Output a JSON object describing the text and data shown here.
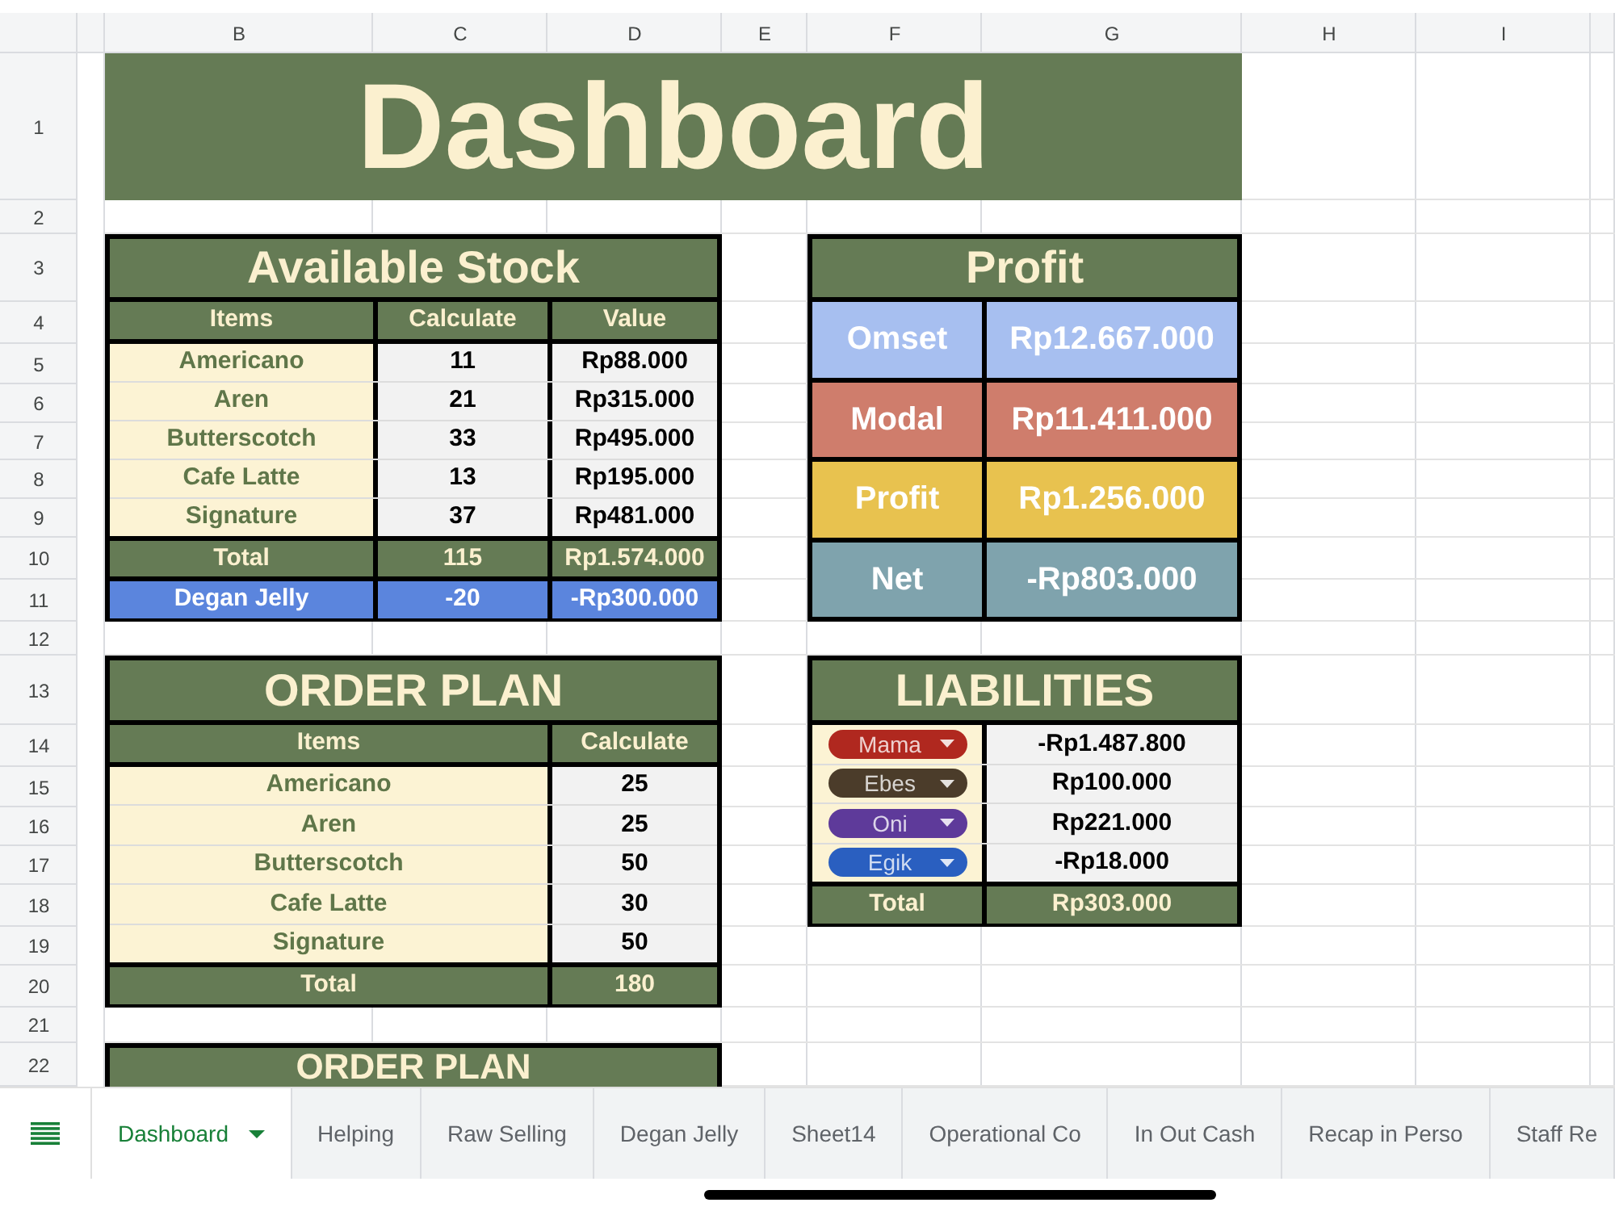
{
  "title": "Dashboard",
  "column_headers": [
    "B",
    "C",
    "D",
    "E",
    "F",
    "G",
    "H",
    "I"
  ],
  "row_numbers": [
    "1",
    "2",
    "3",
    "4",
    "5",
    "6",
    "7",
    "8",
    "9",
    "10",
    "11",
    "12",
    "13",
    "14",
    "15",
    "16",
    "17",
    "18",
    "19",
    "20",
    "21",
    "22"
  ],
  "available_stock": {
    "title": "Available Stock",
    "columns": [
      "Items",
      "Calculate",
      "Value"
    ],
    "rows": [
      {
        "item": "Americano",
        "calculate": "11",
        "value": "Rp88.000"
      },
      {
        "item": "Aren",
        "calculate": "21",
        "value": "Rp315.000"
      },
      {
        "item": "Butterscotch",
        "calculate": "33",
        "value": "Rp495.000"
      },
      {
        "item": "Cafe Latte",
        "calculate": "13",
        "value": "Rp195.000"
      },
      {
        "item": "Signature",
        "calculate": "37",
        "value": "Rp481.000"
      }
    ],
    "total": {
      "label": "Total",
      "calculate": "115",
      "value": "Rp1.574.000"
    },
    "extra_row": {
      "label": "Degan Jelly",
      "calculate": "-20",
      "value": "-Rp300.000"
    }
  },
  "profit": {
    "title": "Profit",
    "rows": [
      {
        "label": "Omset",
        "value": "Rp12.667.000",
        "color": "#a7bff0"
      },
      {
        "label": "Modal",
        "value": "Rp11.411.000",
        "color": "#cf7d6c"
      },
      {
        "label": "Profit",
        "value": "Rp1.256.000",
        "color": "#e8c24f"
      },
      {
        "label": "Net",
        "value": "-Rp803.000",
        "color": "#7fa3ad"
      }
    ]
  },
  "order_plan": {
    "title": "ORDER PLAN",
    "columns": [
      "Items",
      "Calculate"
    ],
    "rows": [
      {
        "item": "Americano",
        "calculate": "25"
      },
      {
        "item": "Aren",
        "calculate": "25"
      },
      {
        "item": "Butterscotch",
        "calculate": "50"
      },
      {
        "item": "Cafe Latte",
        "calculate": "30"
      },
      {
        "item": "Signature",
        "calculate": "50"
      }
    ],
    "total": {
      "label": "Total",
      "calculate": "180"
    }
  },
  "liabilities": {
    "title": "LIABILITIES",
    "rows": [
      {
        "person": "Mama",
        "amount": "-Rp1.487.800",
        "color": "#b0281f"
      },
      {
        "person": "Ebes",
        "amount": "Rp100.000",
        "color": "#4b3c2a"
      },
      {
        "person": "Oni",
        "amount": "Rp221.000",
        "color": "#5e3a9a"
      },
      {
        "person": "Egik",
        "amount": "-Rp18.000",
        "color": "#2a5fc0"
      }
    ],
    "total": {
      "label": "Total",
      "amount": "Rp303.000"
    }
  },
  "order_plan_2": {
    "title": "ORDER PLAN"
  },
  "sheet_tabs": [
    {
      "label": "Dashboard",
      "selected": true
    },
    {
      "label": "Helping",
      "selected": false
    },
    {
      "label": "Raw Selling",
      "selected": false
    },
    {
      "label": "Degan Jelly",
      "selected": false
    },
    {
      "label": "Sheet14",
      "selected": false
    },
    {
      "label": "Operational Co",
      "selected": false
    },
    {
      "label": "In Out Cash",
      "selected": false
    },
    {
      "label": "Recap in Perso",
      "selected": false
    },
    {
      "label": "Staff Re",
      "selected": false
    }
  ]
}
